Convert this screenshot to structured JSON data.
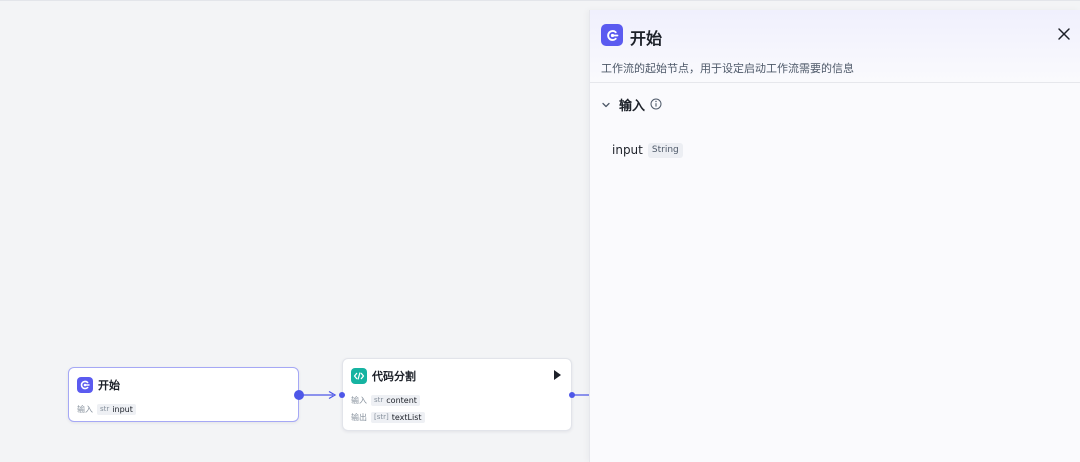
{
  "colors": {
    "canvas": "#f3f4f6",
    "accent": "#5b5bf0",
    "code_node": "#16b3a1",
    "edge": "#4e57e8"
  },
  "nodes": {
    "start": {
      "title": "开始",
      "icon": "start-node-icon",
      "input_label": "输入",
      "input_type": "str",
      "input_name": "input"
    },
    "code": {
      "title": "代码分割",
      "icon": "code-brackets-icon",
      "input_label": "输入",
      "input_type": "str",
      "input_name": "content",
      "output_label": "输出",
      "output_type": "[str]",
      "output_name": "textList",
      "run_icon": "play-icon"
    }
  },
  "panel": {
    "title": "开始",
    "icon": "start-node-icon",
    "close_icon": "close-icon",
    "description": "工作流的起始节点，用于设定启动工作流需要的信息",
    "section": {
      "title": "输入",
      "collapse_icon": "chevron-down-icon",
      "info_icon": "info-icon",
      "variables": [
        {
          "name": "input",
          "type": "String"
        }
      ]
    }
  }
}
